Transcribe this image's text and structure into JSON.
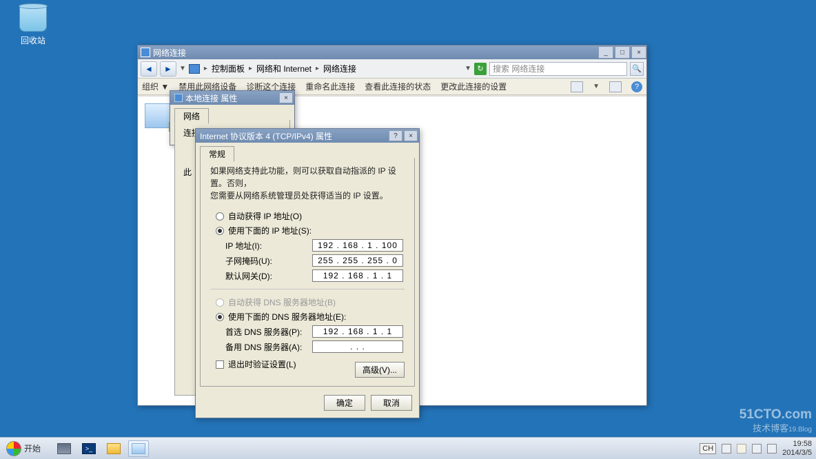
{
  "desktop": {
    "recycle_bin": "回收站"
  },
  "explorer": {
    "title": "网络连接",
    "breadcrumb": {
      "cp": "控制面板",
      "net": "网络和 Internet",
      "conn": "网络连接"
    },
    "search_placeholder": "搜索 网络连接",
    "toolbar": {
      "organize": "组织 ▼",
      "disable": "禁用此网络设备",
      "diagnose": "诊断这个连接",
      "rename": "重命名此连接",
      "status": "查看此连接的状态",
      "change": "更改此连接的设置"
    }
  },
  "props_dialog": {
    "title": "本地连接 属性",
    "tab": "网络",
    "intro": "连接时使用："
  },
  "ipv4_dialog": {
    "title": "Internet 协议版本 4 (TCP/IPv4) 属性",
    "tab": "常规",
    "desc1": "如果网络支持此功能，则可以获取自动指派的 IP 设置。否则，",
    "desc2": "您需要从网络系统管理员处获得适当的 IP 设置。",
    "radio_auto_ip": "自动获得 IP 地址(O)",
    "radio_use_ip": "使用下面的 IP 地址(S):",
    "ip_label": "IP 地址(I):",
    "ip_value": "192 . 168 .  1  . 100",
    "mask_label": "子网掩码(U):",
    "mask_value": "255 . 255 . 255 .  0",
    "gw_label": "默认网关(D):",
    "gw_value": "192 . 168 .  1  .  1",
    "radio_auto_dns": "自动获得 DNS 服务器地址(B)",
    "radio_use_dns": "使用下面的 DNS 服务器地址(E):",
    "dns1_label": "首选 DNS 服务器(P):",
    "dns1_value": "192 . 168 .  1  .  1",
    "dns2_label": "备用 DNS 服务器(A):",
    "dns2_value": " .       .       .",
    "chk_validate": "退出时验证设置(L)",
    "btn_adv": "高级(V)...",
    "btn_ok": "确定",
    "btn_cancel": "取消"
  },
  "watermark": {
    "main": "51CTO.com",
    "sub": "技术博客",
    "tiny": "19.Blog"
  },
  "taskbar": {
    "start": "开始",
    "tray": {
      "ime": "CH",
      "time": "19:58",
      "date": "2014/3/5"
    }
  }
}
